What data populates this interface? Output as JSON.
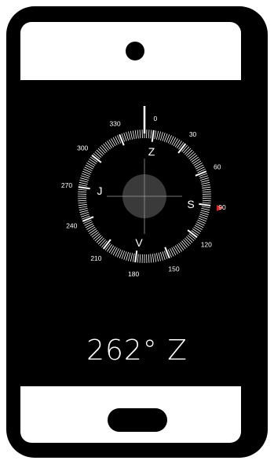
{
  "compass": {
    "heading_degrees": 262,
    "degree_labels": [
      "0",
      "30",
      "60",
      "90",
      "120",
      "150",
      "180",
      "210",
      "240",
      "270",
      "300",
      "330"
    ],
    "cardinals": {
      "north": "Z",
      "east": "S",
      "south": "V",
      "west": "J"
    },
    "colors": {
      "background": "#000000",
      "dial": "#ffffff",
      "center_disc": "#3a3a3a",
      "marker": "#e0201a"
    }
  },
  "display": {
    "heading_text": "262° Z"
  }
}
